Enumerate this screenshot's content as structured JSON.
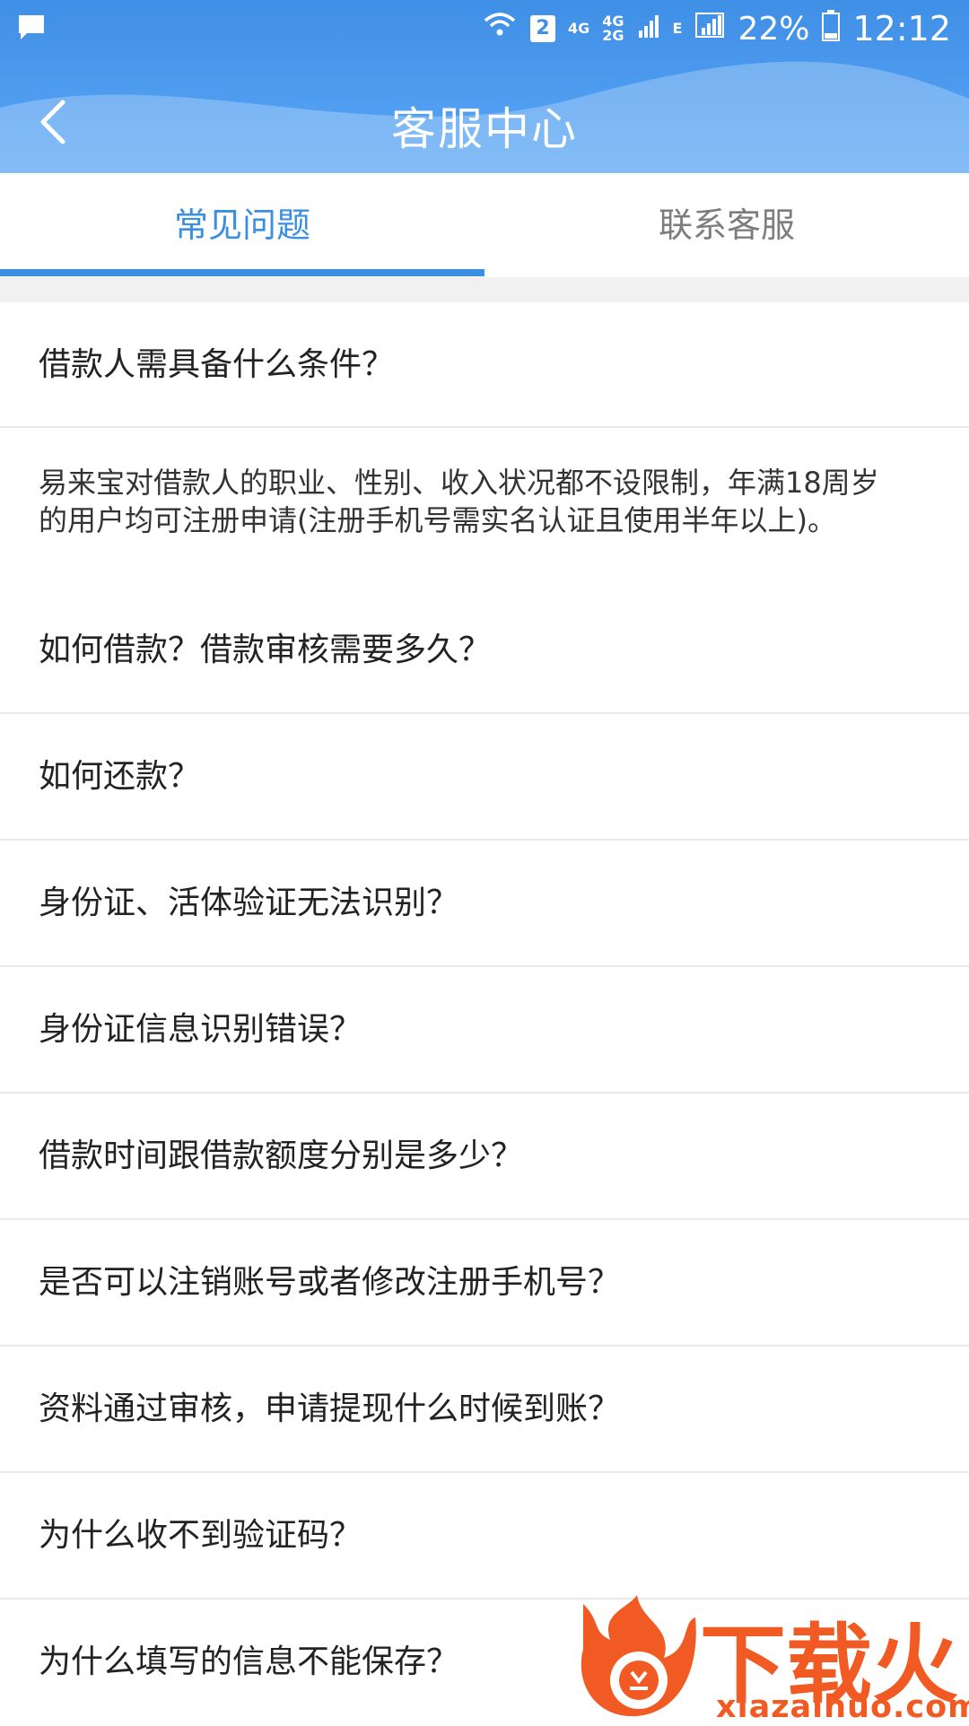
{
  "status_bar": {
    "sim": "2",
    "net1": "4G",
    "net2_top": "4G",
    "net2_bottom": "2G",
    "net3": "E",
    "battery": "22%",
    "time": "12:12"
  },
  "header": {
    "title": "客服中心"
  },
  "tabs": [
    {
      "label": "常见问题"
    },
    {
      "label": "联系客服"
    }
  ],
  "faq": [
    {
      "q": "借款人需具备什么条件？"
    },
    {
      "q": "如何借款？借款审核需要多久？"
    },
    {
      "q": "如何还款？"
    },
    {
      "q": "身份证、活体验证无法识别？"
    },
    {
      "q": "身份证信息识别错误？"
    },
    {
      "q": "借款时间跟借款额度分别是多少？"
    },
    {
      "q": "是否可以注销账号或者修改注册手机号？"
    },
    {
      "q": "资料通过审核，申请提现什么时候到账？"
    },
    {
      "q": "为什么收不到验证码？"
    },
    {
      "q": "为什么填写的信息不能保存？"
    }
  ],
  "answer": {
    "line1": "易来宝对借款人的职业、性别、收入状况都不设限制，年满18周岁",
    "line2": "的用户均可注册申请(注册手机号需实名认证且使用半年以上)。"
  },
  "watermark": {
    "brand": "下载火",
    "url": "xiazaihuo.com"
  },
  "colors": {
    "header": "#4e9cf0",
    "accent": "#3b8fe0",
    "watermark": "#f15a22"
  }
}
